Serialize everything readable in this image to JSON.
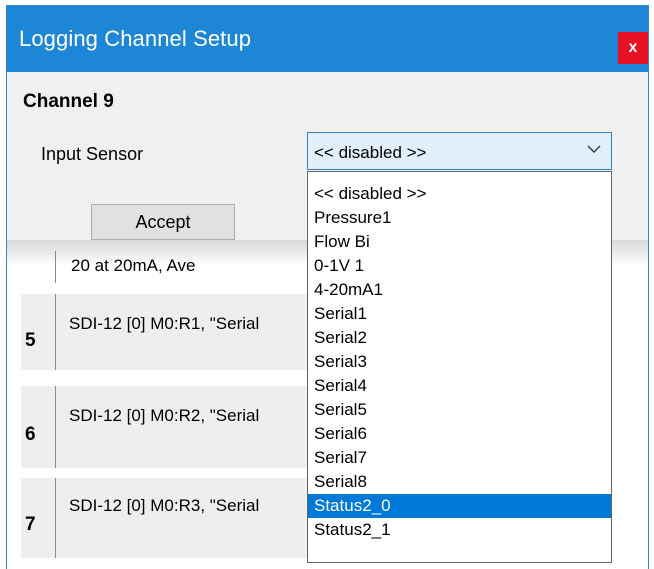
{
  "window": {
    "title": "Logging Channel Setup",
    "close_glyph": "x"
  },
  "channel": {
    "label": "Channel 9"
  },
  "input_sensor": {
    "label": "Input Sensor",
    "selected_value": "<< disabled >>",
    "options": [
      "<< disabled >>",
      "Pressure1",
      "Flow Bi",
      "0-1V 1",
      "4-20mA1",
      "Serial1",
      "Serial2",
      "Serial3",
      "Serial4",
      "Serial5",
      "Serial6",
      "Serial7",
      "Serial8",
      "Status2_0",
      "Status2_1"
    ],
    "highlighted_option": "Status2_0"
  },
  "accept_button": {
    "label": "Accept"
  },
  "background_list": {
    "partial_text": "20 at 20mA, Ave",
    "rows": [
      {
        "num": "5",
        "text": "SDI-12 [0] M0:R1, \"Serial"
      },
      {
        "num": "6",
        "text": "SDI-12 [0] M0:R2, \"Serial"
      },
      {
        "num": "7",
        "text": "SDI-12 [0] M0:R3, \"Serial"
      }
    ]
  },
  "colors": {
    "titlebar": "#1d86d6",
    "close": "#e81123",
    "highlight": "#0078d7"
  },
  "icons": {
    "close": "close-icon",
    "dropdown": "chevron-down-icon"
  }
}
